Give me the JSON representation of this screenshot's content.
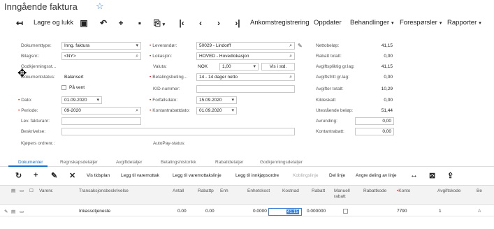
{
  "header": {
    "title": "Inngående faktura"
  },
  "toolbar": {
    "save_close": "Lagre og lukk",
    "receipt_register": "Ankomstregistrering",
    "update": "Oppdater",
    "actions": "Behandlinger",
    "inquiries": "Forespørsler",
    "reports": "Rapporter"
  },
  "form": {
    "doc_type_label": "Dokumenttype:",
    "doc_type_value": "Inng. faktura",
    "ref_label": "Bilagsnr.:",
    "ref_value": "<NY>",
    "approval_label": "Godkjenningsst...",
    "status_label": "Dokumentstatus:",
    "status_value": "Balansert",
    "hold_label": "På vent",
    "date_label": "Dato:",
    "date_value": "01.09.2020",
    "period_label": "Periode:",
    "period_value": "09-2020",
    "vendor_ref_label": "Lev. fakturanr:",
    "description_label": "Beskrivelse:",
    "buyer_order_label": "Kjøpers ordrenr.:",
    "vendor_label": "Leverandør:",
    "vendor_value": "50029 - Lindorff",
    "location_label": "Lokasjon:",
    "location_value": "HOVED - Hovedlokasjon",
    "currency_label": "Valuta:",
    "currency_value": "NOK",
    "rate_value": "1,00",
    "view_base": "Vis i std.",
    "terms_label": "Betalingsbeting...",
    "terms_value": "14 - 14 dager netto",
    "kid_label": "KID-nummer:",
    "due_label": "Forfallsdato:",
    "due_value": "15.09.2020",
    "cash_disc_label": "Kontantrabattdato:",
    "cash_disc_value": "01.09.2020",
    "autopay_label": "AutoPay-status:"
  },
  "totals": {
    "net_label": "Nettobeløp:",
    "net_value": "41,15",
    "disc_label": "Rabatt totalt:",
    "disc_value": "0,00",
    "taxable_label": "Avgiftspliktig gr.lag:",
    "taxable_value": "41,15",
    "exempt_label": "Avgiftsfritt gr.lag:",
    "exempt_value": "0,00",
    "tax_label": "Avgifter totalt:",
    "tax_value": "10,29",
    "source_tax_label": "Kildeskatt",
    "source_tax_value": "0,00",
    "balance_label": "Utestående beløp:",
    "balance_value": "51,44",
    "rounding_label": "Avrunding:",
    "rounding_value": "0,00",
    "cash_disc_label": "Kontantrabatt:",
    "cash_disc_value": "0,00"
  },
  "tabs": [
    "Dokumenter",
    "Regnskapsdetaljer",
    "Avgiftdetaljer",
    "Betalingshistorikk",
    "Rabattdetaljer",
    "Godkjenningsdetaljer"
  ],
  "grid_toolbar": {
    "show_schedule": "Vis tidsplan",
    "add_receipt": "Legg til varemottak",
    "add_receipt_line": "Legg til varemottakslinje",
    "add_po": "Legg til innkjøpsordre",
    "link_line": "Koblingslinje",
    "split_line": "Del linje",
    "alloc_line": "Angre deling av linje"
  },
  "grid": {
    "columns": {
      "inventory": "Varenr.",
      "description": "Transaksjonsbeskrivelse",
      "qty": "Antall",
      "disc_pct": "Rabattp",
      "uom": "Enh",
      "unit_cost": "Enhetskost",
      "cost": "Kostnad",
      "disc_amt": "Rabatt",
      "manual_disc": "Manuell rabatt",
      "disc_code": "Rabattkode",
      "account": "Konto",
      "tax_code": "Avgiftskode",
      "more": "Be"
    },
    "rows": [
      {
        "description": "Inkassotjeneste",
        "qty": "0.00",
        "disc_pct": "0.00",
        "unit_cost": "0.0000",
        "cost": "41.15",
        "disc_amt": "0.000000",
        "account": "7790",
        "tax_code": "1",
        "more": "A"
      }
    ]
  },
  "colors": {
    "accent": "#1a6fc9",
    "required": "#dd2222"
  }
}
